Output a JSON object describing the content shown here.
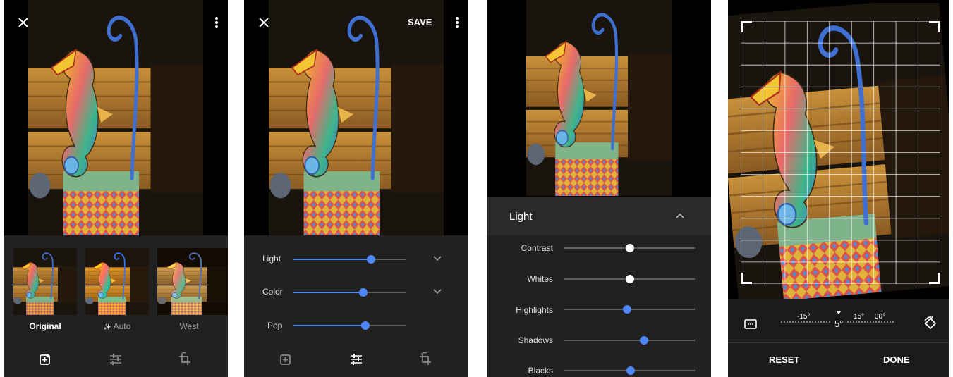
{
  "colors": {
    "accent": "#4f86f7",
    "panel": "#212121",
    "dark_panel": "#2a2a2a",
    "knob_white": "#ffffff"
  },
  "screen1": {
    "close_icon": "close-icon",
    "more_icon": "more-vert-icon",
    "filters": [
      {
        "label": "Original",
        "selected": true
      },
      {
        "label": "Auto",
        "icon": "auto-sparkle-icon"
      },
      {
        "label": "West"
      }
    ],
    "auto_sparkle": "✨",
    "tools": [
      "filters-icon",
      "adjust-icon",
      "crop-rotate-icon"
    ]
  },
  "screen2": {
    "save_label": "SAVE",
    "sliders": [
      {
        "label": "Light",
        "value": 0.69,
        "expandable": true
      },
      {
        "label": "Color",
        "value": 0.62,
        "expandable": true
      },
      {
        "label": "Pop",
        "value": 0.64,
        "expandable": false
      }
    ]
  },
  "screen3": {
    "section_title": "Light",
    "sliders": [
      {
        "label": "Contrast",
        "value": 0.5,
        "fill": false
      },
      {
        "label": "Whites",
        "value": 0.5,
        "fill": false
      },
      {
        "label": "Highlights",
        "value": 0.48,
        "fill": true
      },
      {
        "label": "Shadows",
        "value": 0.61,
        "fill": true
      },
      {
        "label": "Blacks",
        "value": 0.51,
        "fill": true
      }
    ]
  },
  "screen4": {
    "ruler_labels": [
      "-15°",
      "5°",
      "15°",
      "30°"
    ],
    "current_angle": "5°",
    "reset_label": "RESET",
    "done_label": "DONE"
  }
}
